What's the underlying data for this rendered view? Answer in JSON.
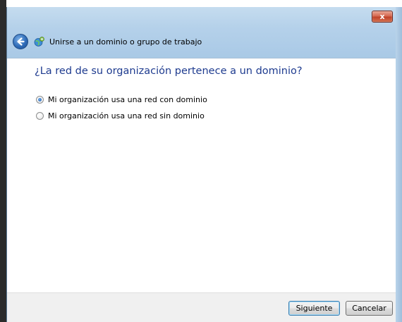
{
  "window": {
    "close_label": "x"
  },
  "titlebar": {
    "title": "Unirse a un dominio o grupo de trabajo",
    "back_icon": "back-arrow-icon",
    "app_icon": "network-icon"
  },
  "page": {
    "question": "¿La red de su organización pertenece a un dominio?",
    "options": [
      {
        "label": "Mi organización usa una red con dominio",
        "selected": true
      },
      {
        "label": "Mi organización usa una red sin dominio",
        "selected": false
      }
    ]
  },
  "footer": {
    "next_label": "Siguiente",
    "cancel_label": "Cancelar"
  },
  "colors": {
    "question_text": "#1e3b8f",
    "frame": "#b5d1ea",
    "close_button": "#c0432a"
  }
}
